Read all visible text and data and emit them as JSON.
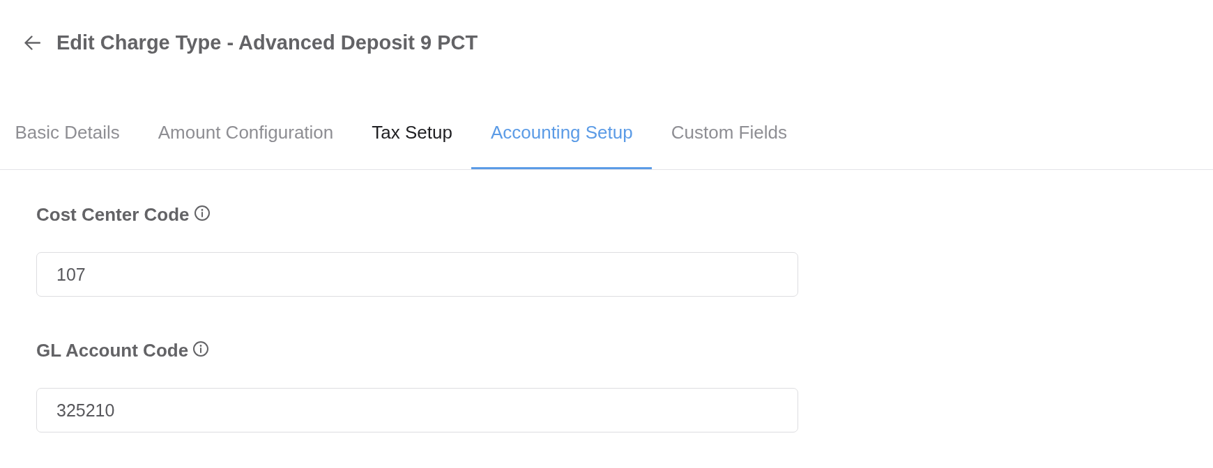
{
  "header": {
    "title": "Edit Charge Type - Advanced Deposit 9 PCT"
  },
  "tabs": [
    {
      "label": "Basic Details",
      "selected": false,
      "hovered": false
    },
    {
      "label": "Amount Configuration",
      "selected": false,
      "hovered": false
    },
    {
      "label": "Tax Setup",
      "selected": false,
      "hovered": true
    },
    {
      "label": "Accounting Setup",
      "selected": true,
      "hovered": false
    },
    {
      "label": "Custom Fields",
      "selected": false,
      "hovered": false
    }
  ],
  "fields": [
    {
      "label": "Cost Center Code",
      "value": "107"
    },
    {
      "label": "GL Account Code",
      "value": "325210"
    }
  ]
}
